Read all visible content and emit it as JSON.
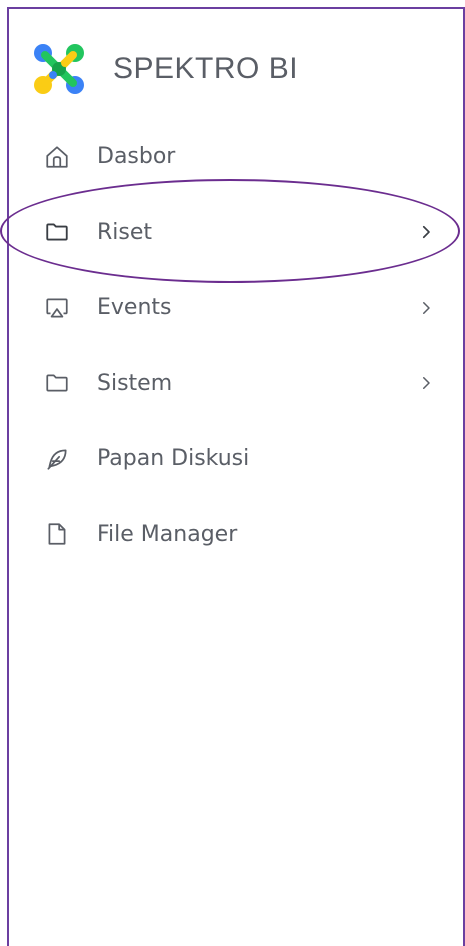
{
  "brand": {
    "name": "SPEKTRO BI",
    "logo_icon": "spektro-logo-icon"
  },
  "menu": {
    "items": [
      {
        "label": "Dasbor",
        "icon": "home-icon",
        "has_submenu": false
      },
      {
        "label": "Riset",
        "icon": "folder-icon",
        "has_submenu": true,
        "highlighted": true
      },
      {
        "label": "Events",
        "icon": "cast-icon",
        "has_submenu": true
      },
      {
        "label": "Sistem",
        "icon": "folder-icon",
        "has_submenu": true
      },
      {
        "label": "Papan Diskusi",
        "icon": "feather-icon",
        "has_submenu": false
      },
      {
        "label": "File Manager",
        "icon": "file-icon",
        "has_submenu": false
      }
    ]
  },
  "colors": {
    "frame": "#6b3fa0",
    "highlight": "#6b2d8f",
    "text": "#5a5e66"
  }
}
